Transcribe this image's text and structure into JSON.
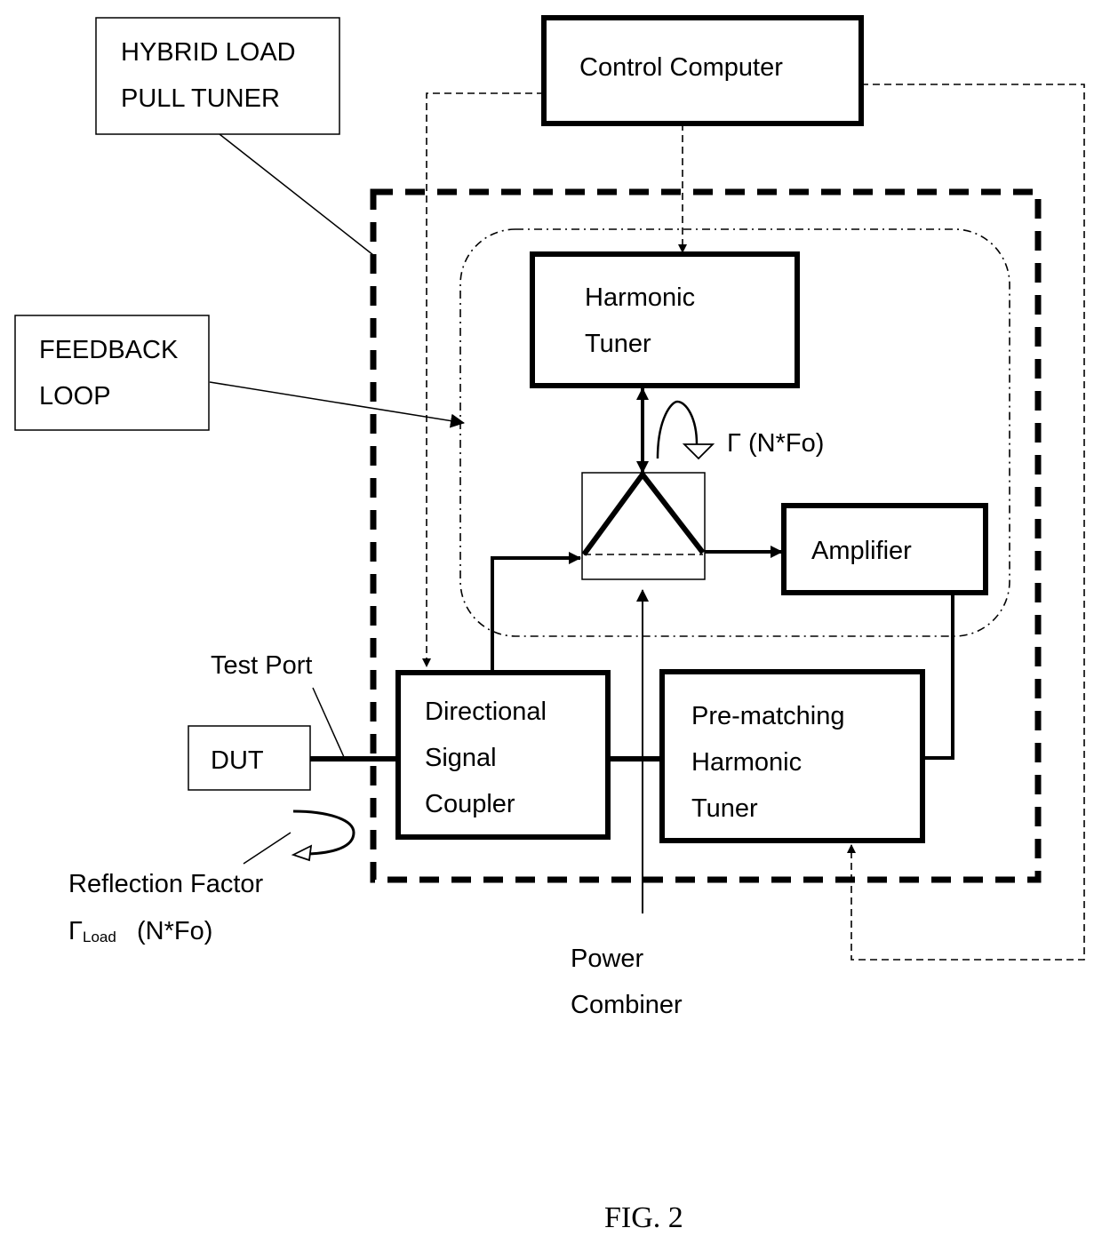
{
  "diagram": {
    "figure_label": "FIG. 2",
    "callouts": {
      "hybrid_tuner": [
        "HYBRID LOAD",
        "PULL TUNER"
      ],
      "feedback_loop": [
        "FEEDBACK",
        "LOOP"
      ]
    },
    "blocks": {
      "control_computer": [
        "Control Computer"
      ],
      "harmonic_tuner": [
        "Harmonic",
        "Tuner"
      ],
      "amplifier": [
        "Amplifier"
      ],
      "directional_coupler": [
        "Directional",
        "Signal",
        "Coupler"
      ],
      "prematching_tuner": [
        "Pre-matching",
        "Harmonic",
        "Tuner"
      ],
      "dut": [
        "DUT"
      ]
    },
    "labels": {
      "gamma_loop": "Γ (N*Fo)",
      "test_port": "Test Port",
      "reflection_factor": "Reflection Factor",
      "gamma_load_symbol": "Γ",
      "gamma_load_subscript": "Load",
      "gamma_load_suffix": "(N*Fo)",
      "power_combiner": [
        "Power",
        "Combiner"
      ]
    }
  }
}
